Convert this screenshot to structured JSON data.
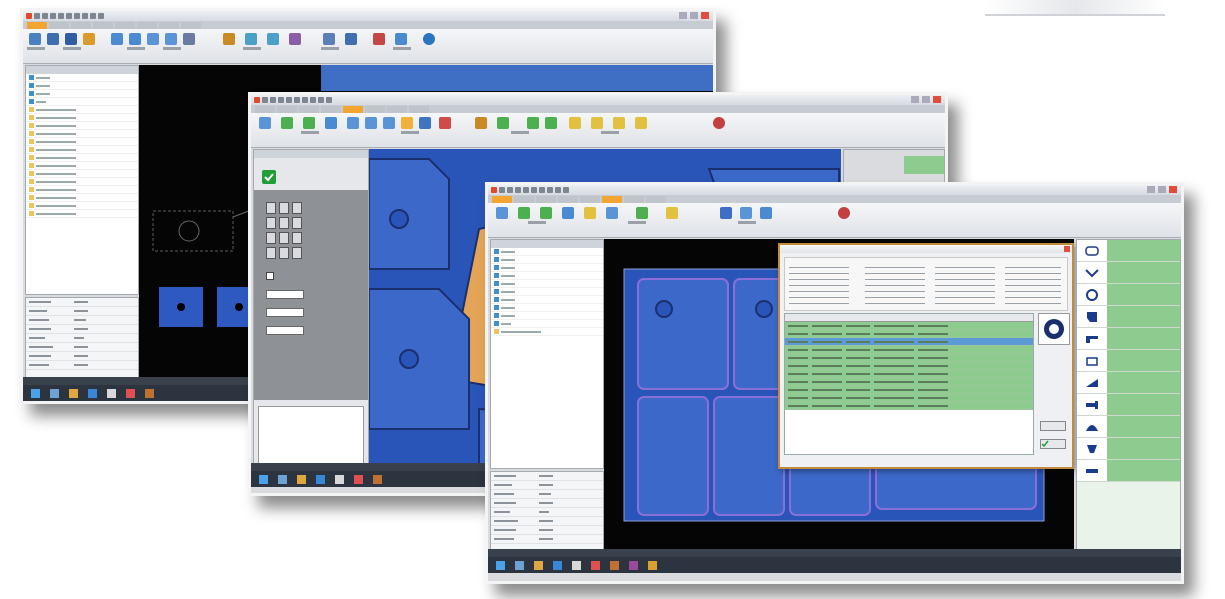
{
  "window1": {
    "title": "",
    "colors": {
      "accent": "#f2a530",
      "canvas": "#050505"
    }
  },
  "window2": {
    "title": "",
    "colors": {
      "accent": "#f2a530",
      "sheet": "#2a55b8"
    }
  },
  "window3": {
    "title": "",
    "dialog_title": "",
    "colors": {
      "accent": "#f2a530",
      "sheet": "#2a55b8",
      "grid": "#8ecb8e"
    }
  },
  "icons": {
    "ok_check": "check-icon",
    "taskbar_start": "windows-start-icon"
  }
}
